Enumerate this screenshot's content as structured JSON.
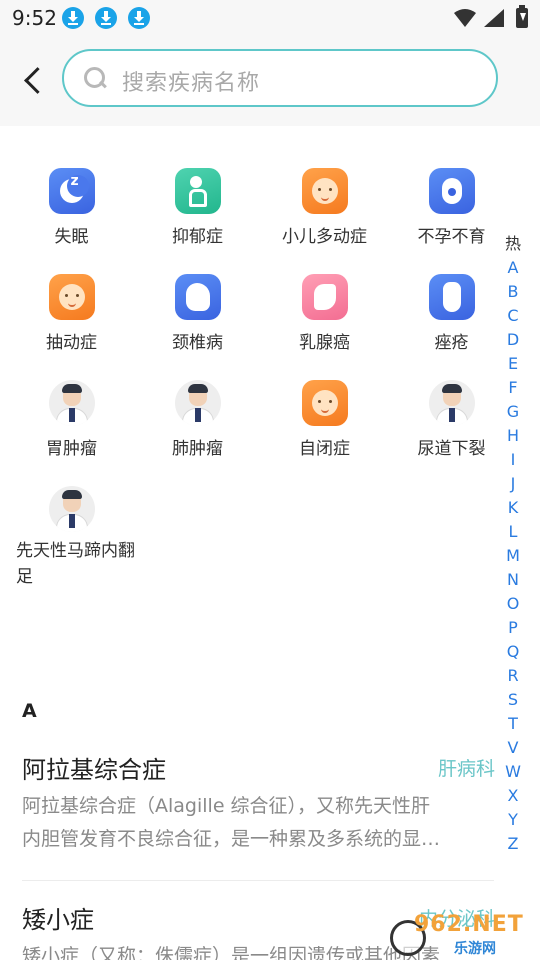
{
  "status_bar": {
    "time": "9:52",
    "download_count": 3
  },
  "search": {
    "placeholder": "搜索疾病名称"
  },
  "conditions": [
    {
      "label": "失眠",
      "icon": "sleep-moon-icon"
    },
    {
      "label": "抑郁症",
      "icon": "depression-person-icon"
    },
    {
      "label": "小儿多动症",
      "icon": "baby-face-icon"
    },
    {
      "label": "不孕不育",
      "icon": "fertility-icon"
    },
    {
      "label": "抽动症",
      "icon": "baby-face-icon"
    },
    {
      "label": "颈椎病",
      "icon": "head-profile-icon"
    },
    {
      "label": "乳腺癌",
      "icon": "breast-icon"
    },
    {
      "label": "痤疮",
      "icon": "hand-skin-icon"
    },
    {
      "label": "胃肿瘤",
      "icon": "doctor-avatar-icon"
    },
    {
      "label": "肺肿瘤",
      "icon": "doctor-avatar-icon"
    },
    {
      "label": "自闭症",
      "icon": "baby-face-icon"
    },
    {
      "label": "尿道下裂",
      "icon": "doctor-avatar-icon"
    },
    {
      "label": "先天性马蹄内翻足",
      "icon": "doctor-avatar-icon"
    }
  ],
  "index": [
    "热",
    "A",
    "B",
    "C",
    "D",
    "E",
    "F",
    "G",
    "H",
    "I",
    "J",
    "K",
    "L",
    "M",
    "N",
    "O",
    "P",
    "Q",
    "R",
    "S",
    "T",
    "V",
    "W",
    "X",
    "Y",
    "Z"
  ],
  "section": {
    "letter": "A",
    "items": [
      {
        "title": "阿拉基综合症",
        "tag": "肝病科",
        "desc_line1": "阿拉基综合症（Alagille 综合征），又称先天性肝",
        "desc_line2": "内胆管发育不良综合征，是一种累及多系统的显…"
      },
      {
        "title": "矮小症",
        "tag": "内分泌科",
        "desc_line1": "矮小症（又称：侏儒症）是一组因遗传或其他因素"
      }
    ]
  },
  "watermark": {
    "brand": "962.NET",
    "sub": "乐游网"
  },
  "colors": {
    "accent": "#5ec7c9",
    "index_blue": "#2a7be0",
    "tag_teal": "#6bc6c8"
  }
}
